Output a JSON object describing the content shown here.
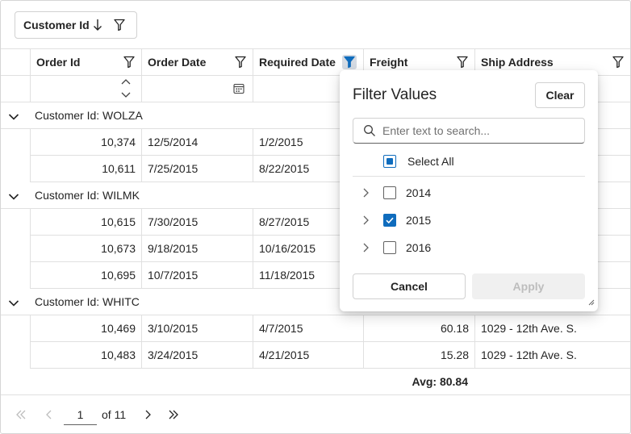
{
  "group_panel": {
    "chip_label": "Customer Id"
  },
  "columns": [
    "Order Id",
    "Order Date",
    "Required Date",
    "Freight",
    "Ship Address"
  ],
  "groups": [
    {
      "label": "Customer Id: WOLZA",
      "rows": [
        {
          "order_id": "10,374",
          "order_date": "12/5/2014",
          "required_date": "1/2/2015"
        },
        {
          "order_id": "10,611",
          "order_date": "7/25/2015",
          "required_date": "8/22/2015"
        }
      ]
    },
    {
      "label": "Customer Id: WILMK",
      "rows": [
        {
          "order_id": "10,615",
          "order_date": "7/30/2015",
          "required_date": "8/27/2015"
        },
        {
          "order_id": "10,673",
          "order_date": "9/18/2015",
          "required_date": "10/16/2015"
        },
        {
          "order_id": "10,695",
          "order_date": "10/7/2015",
          "required_date": "11/18/2015"
        }
      ]
    },
    {
      "label": "Customer Id: WHITC",
      "rows": [
        {
          "order_id": "10,469",
          "order_date": "3/10/2015",
          "required_date": "4/7/2015",
          "freight": "60.18",
          "ship_address": "1029 - 12th Ave. S."
        },
        {
          "order_id": "10,483",
          "order_date": "3/24/2015",
          "required_date": "4/21/2015",
          "freight": "15.28",
          "ship_address": "1029 - 12th Ave. S."
        }
      ]
    }
  ],
  "summary": {
    "avg_label": "Avg: 80.84"
  },
  "pager": {
    "page": "1",
    "of_label": "of 11"
  },
  "filter_popup": {
    "title": "Filter Values",
    "clear_label": "Clear",
    "search_placeholder": "Enter text to search...",
    "select_all_label": "Select All",
    "items": [
      {
        "label": "2014",
        "checked": false
      },
      {
        "label": "2015",
        "checked": true
      },
      {
        "label": "2016",
        "checked": false
      }
    ],
    "cancel_label": "Cancel",
    "apply_label": "Apply"
  },
  "colors": {
    "accent": "#0f6cbd",
    "border": "#e0e0e0"
  }
}
